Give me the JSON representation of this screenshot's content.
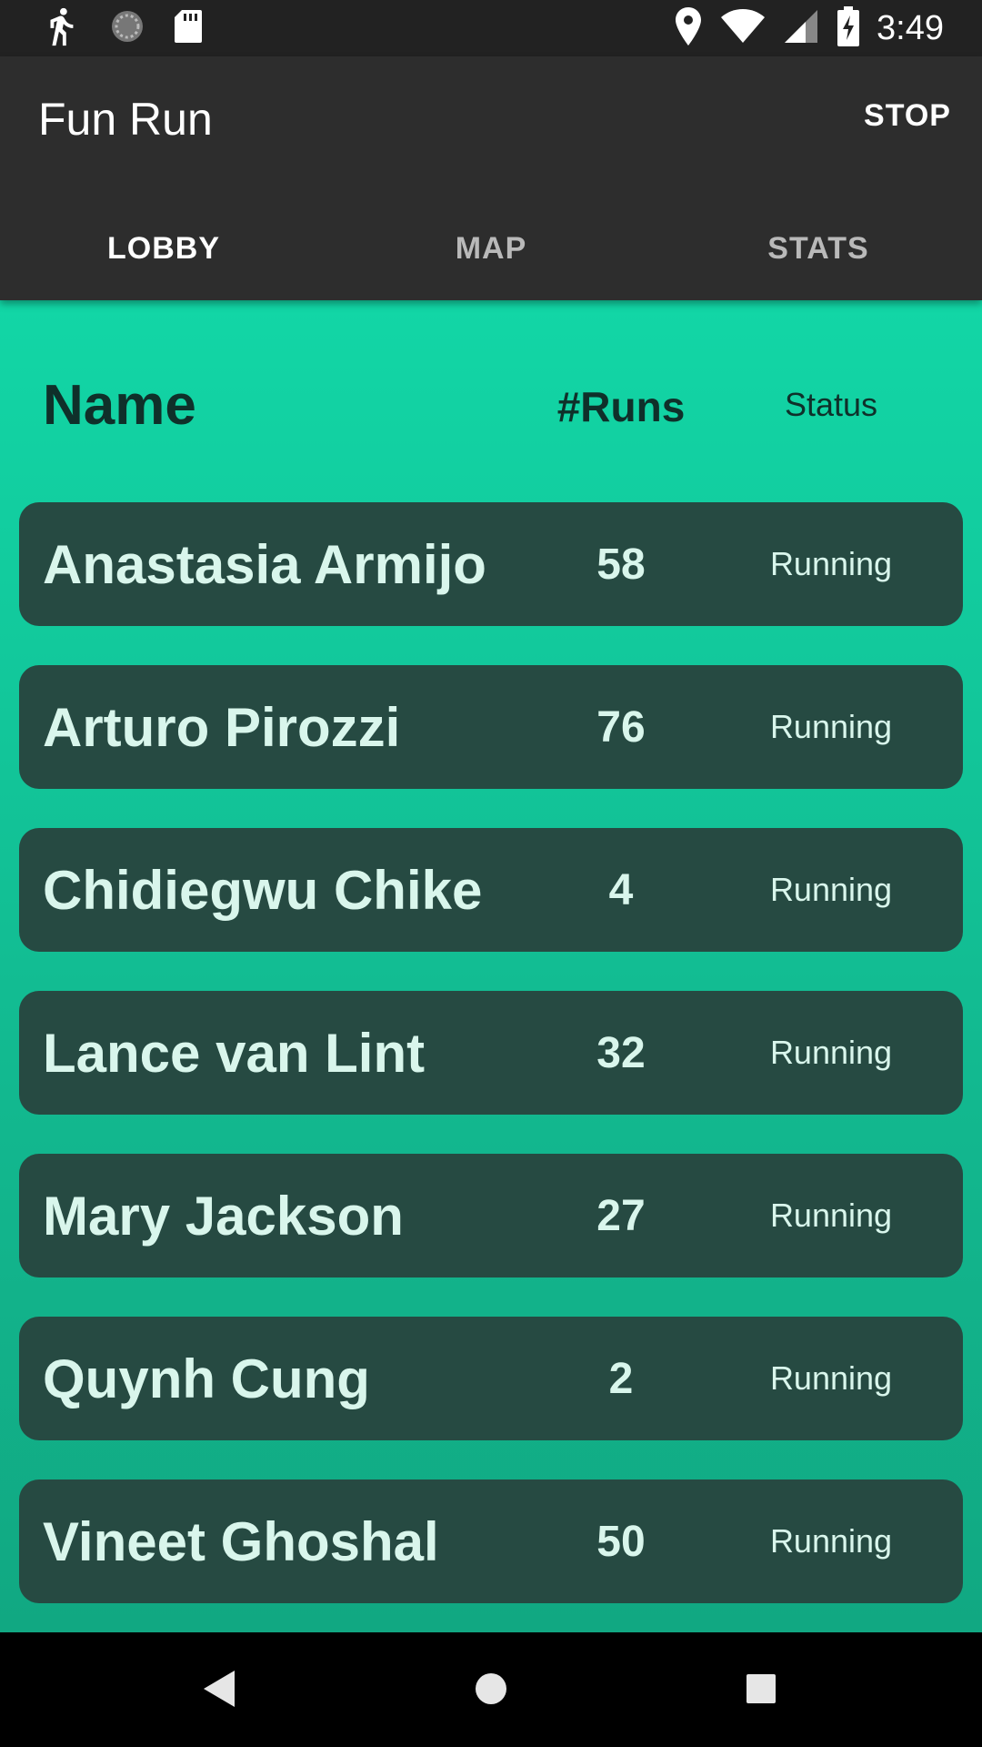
{
  "status_bar": {
    "time": "3:49",
    "left_icons": [
      "running-figure-icon",
      "sync-circle-icon",
      "sd-card-icon"
    ],
    "right_icons": [
      "location-pin-icon",
      "wifi-icon",
      "signal-icon",
      "battery-charging-icon"
    ]
  },
  "app_bar": {
    "title": "Fun Run",
    "action_label": "STOP"
  },
  "tabs": [
    {
      "label": "LOBBY",
      "active": true
    },
    {
      "label": "MAP",
      "active": false
    },
    {
      "label": "STATS",
      "active": false
    }
  ],
  "table": {
    "headers": {
      "name": "Name",
      "runs": "#Runs",
      "status": "Status"
    },
    "rows": [
      {
        "name": "Anastasia Armijo",
        "runs": "58",
        "status": "Running"
      },
      {
        "name": "Arturo Pirozzi",
        "runs": "76",
        "status": "Running"
      },
      {
        "name": "Chidiegwu Chike",
        "runs": "4",
        "status": "Running"
      },
      {
        "name": "Lance van Lint",
        "runs": "32",
        "status": "Running"
      },
      {
        "name": "Mary Jackson",
        "runs": "27",
        "status": "Running"
      },
      {
        "name": "Quynh Cung",
        "runs": "2",
        "status": "Running"
      },
      {
        "name": "Vineet Ghoshal",
        "runs": "50",
        "status": "Running"
      }
    ]
  },
  "nav_bar": {
    "icons": [
      "back-icon",
      "home-icon",
      "recents-icon"
    ]
  },
  "colors": {
    "accent": "#12d6a6",
    "row_bg": "#264a42",
    "row_text": "#d9f6ec",
    "app_bar": "#2d2d2d"
  }
}
